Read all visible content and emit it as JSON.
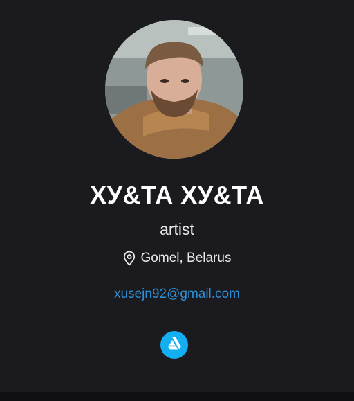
{
  "profile": {
    "name": "ХУ&ТА ХУ&ТА",
    "role": "artist",
    "location": "Gomel, Belarus",
    "email": "xusejn92@gmail.com"
  },
  "icons": {
    "location": "map-pin-icon",
    "social": "artstation-icon"
  },
  "colors": {
    "background": "#1b1b1f",
    "page_background": "#0f0f11",
    "email_link": "#2f8fd4",
    "social_badge": "#13aff0"
  }
}
